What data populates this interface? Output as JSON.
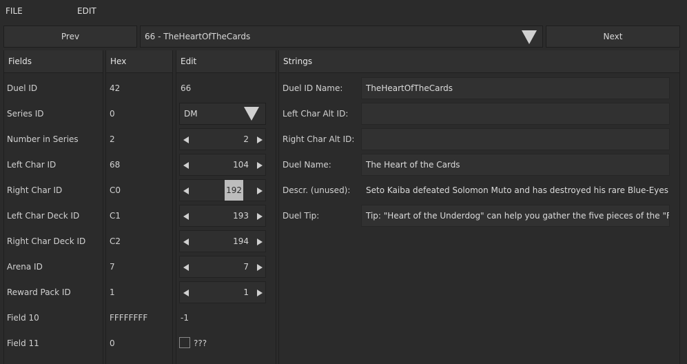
{
  "menu": {
    "file": "FILE",
    "edit": "EDIT"
  },
  "nav": {
    "prev": "Prev",
    "next": "Next",
    "selected_duel": "66 - TheHeartOfTheCards"
  },
  "headers": {
    "fields": "Fields",
    "hex": "Hex",
    "edit": "Edit",
    "strings": "Strings"
  },
  "rows": [
    {
      "field": "Duel ID",
      "hex": "42",
      "edit": "66"
    },
    {
      "field": "Series ID",
      "hex": "0",
      "edit": "DM"
    },
    {
      "field": "Number in Series",
      "hex": "2",
      "edit": "2"
    },
    {
      "field": "Left Char ID",
      "hex": "68",
      "edit": "104"
    },
    {
      "field": "Right Char ID",
      "hex": "C0",
      "edit": "192"
    },
    {
      "field": "Left Char Deck ID",
      "hex": "C1",
      "edit": "193"
    },
    {
      "field": "Right Char Deck ID",
      "hex": "C2",
      "edit": "194"
    },
    {
      "field": "Arena ID",
      "hex": "7",
      "edit": "7"
    },
    {
      "field": "Reward Pack ID",
      "hex": "1",
      "edit": "1"
    },
    {
      "field": "Field 10",
      "hex": "FFFFFFFF",
      "edit": "-1"
    },
    {
      "field": "Field 11",
      "hex": "0",
      "edit": "???"
    }
  ],
  "strings": [
    {
      "label": "Duel ID Name:",
      "value": "TheHeartOfTheCards"
    },
    {
      "label": "Left Char Alt ID:",
      "value": ""
    },
    {
      "label": "Right Char Alt ID:",
      "value": ""
    },
    {
      "label": "Duel Name:",
      "value": "The Heart of the Cards"
    },
    {
      "label": "Descr. (unused):",
      "value": "Seto Kaiba defeated Solomon Muto and has destroyed his rare Blue-Eyes Wl"
    },
    {
      "label": "Duel Tip:",
      "value": "Tip: \"Heart of the Underdog\" can help you gather the five pieces of the \"Fo"
    }
  ],
  "colors": {
    "background": "#2b2b2b",
    "panel_header": "#303030",
    "selection": "#bdbdbd"
  }
}
